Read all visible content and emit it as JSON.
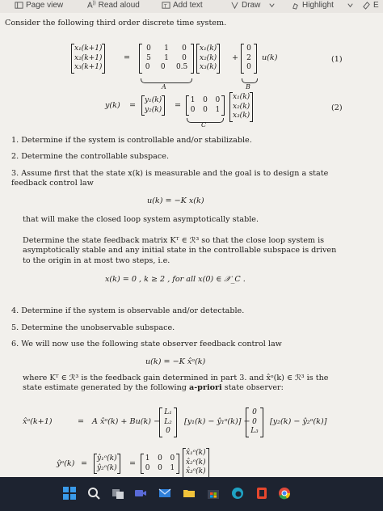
{
  "toolbar": {
    "page_view": "Page view",
    "read_aloud": "Read aloud",
    "add_text": "Add text",
    "draw": "Draw",
    "highlight": "Highlight",
    "erase_partial": "E"
  },
  "doc": {
    "intro": "Consider the following third order discrete time system.",
    "eq1": {
      "state": [
        "x₁(k+1)",
        "x₂(k+1)",
        "x₃(k+1)"
      ],
      "A": [
        [
          "0",
          "1",
          "0"
        ],
        [
          "5",
          "1",
          "0"
        ],
        [
          "0",
          "0",
          "0.5"
        ]
      ],
      "x": [
        "x₁(k)",
        "x₂(k)",
        "x₃(k)"
      ],
      "B": [
        "0",
        "2",
        "0"
      ],
      "u": "u(k)",
      "labelA": "A",
      "labelB": "B",
      "number": "(1)"
    },
    "eq2": {
      "lhs": "y(k)",
      "y": [
        "y₁(k)",
        "y₂(k)"
      ],
      "C": [
        [
          "1",
          "0",
          "0"
        ],
        [
          "0",
          "0",
          "1"
        ]
      ],
      "x": [
        "x₁(k)",
        "x₂(k)",
        "x₃(k)"
      ],
      "labelC": "C",
      "number": "(2)"
    },
    "items": [
      "1. Determine if the system is controllable and/or stabilizable.",
      "2. Determine the controllable subspace.",
      "3. Assume first that the state x(k) is measurable and the goal is to design a state feedback control law",
      "4. Determine if the system is observable and/or detectable.",
      "5. Determine the unobservable subspace.",
      "6. We will now use the following state observer feedback control law"
    ],
    "control_law": "u(k) = −K x(k)",
    "p3_after": "that will make the closed loop system asymptotically stable.",
    "p3_para": "Determine the state feedback matrix Kᵀ ∈ ℛ³ so that the close loop system is asymptotically stable and any initial state in the controllable subspace is driven to the origin in at most two steps, i.e.",
    "p3_eq": "x(k) = 0 , k ≥ 2 ,        for all x(0) ∈ 𝒳_C .",
    "observer_law": "u(k) = −K x̂ᵒ(k)",
    "p6_para_a": "where Kᵀ ∈ ℛ³ is the feedback gain determined in part 3. and x̂ᵒ(k) ∈ ℛ³ is the state estimate generated by the following",
    "p6_bold": "a-priori",
    "p6_para_b": "state observer:",
    "obs_lhs": "x̂ᵒ(k+1)",
    "obs_eq": "=",
    "obs_term1": "A x̂ᵒ(k) + Bu(k) −",
    "obs_L": [
      "L₁",
      "L₂",
      "0"
    ],
    "obs_term2": "[y₁(k) − ŷ₁ᵒ(k)] −",
    "obs_L3": [
      "0",
      "0",
      "L₃"
    ],
    "obs_term3": "[y₂(k) − ŷ₂ᵒ(k)]",
    "yhat_lhs": "ŷᵒ(k)",
    "yhat": [
      "ŷ₁ᵒ(k)",
      "ŷ₂ᵒ(k)"
    ],
    "C2": [
      [
        "1",
        "0",
        "0"
      ],
      [
        "0",
        "0",
        "1"
      ]
    ],
    "xhat": [
      "x̂₁ᵒ(k)",
      "x̂₂ᵒ(k)",
      "x̂₃ᵒ(k)"
    ]
  },
  "taskbar": {
    "icons": [
      "windows-start-icon",
      "search-icon",
      "task-view-icon",
      "video-icon",
      "mail-icon",
      "file-explorer-icon",
      "store-icon",
      "edge-icon",
      "office-icon",
      "chrome-icon"
    ]
  }
}
